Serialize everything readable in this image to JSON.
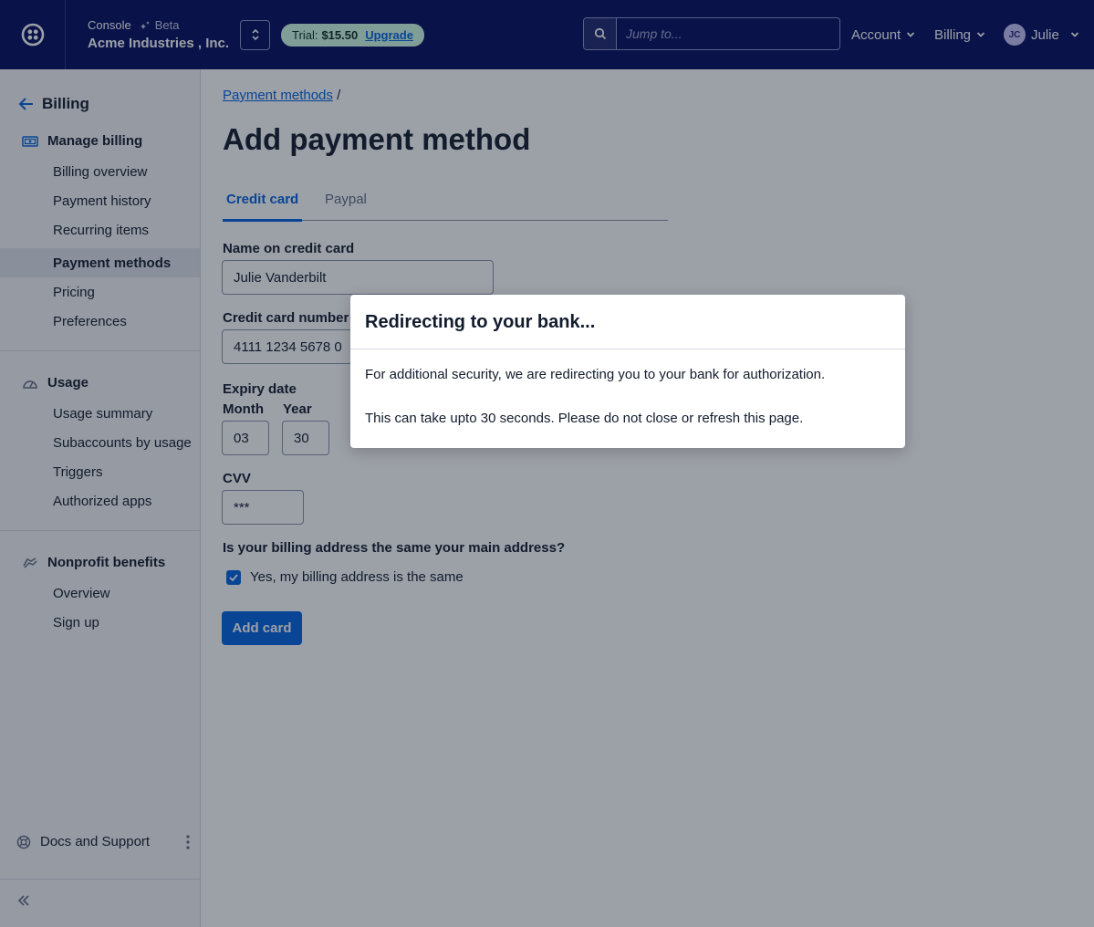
{
  "header": {
    "console_label": "Console",
    "beta_label": "Beta",
    "account_name": "Acme Industries , Inc.",
    "trial_label": "Trial:",
    "trial_amount": "$15.50",
    "upgrade_label": "Upgrade",
    "search_placeholder": "Jump to...",
    "nav": {
      "account": "Account",
      "billing": "Billing",
      "user_initials": "JC",
      "user_name": "Julie"
    }
  },
  "sidebar": {
    "back_label": "Billing",
    "sections": [
      {
        "title": "Manage billing",
        "items": [
          "Billing overview",
          "Payment history",
          "Recurring items",
          "Payment methods",
          "Pricing",
          "Preferences"
        ]
      },
      {
        "title": "Usage",
        "items": [
          "Usage summary",
          "Subaccounts by usage",
          "Triggers",
          "Authorized apps"
        ]
      },
      {
        "title": "Nonprofit benefits",
        "items": [
          "Overview",
          "Sign up"
        ]
      }
    ],
    "active_item": "Payment methods",
    "docs_label": "Docs and Support"
  },
  "main": {
    "breadcrumb_link": "Payment methods",
    "breadcrumb_sep": "/",
    "title": "Add payment method",
    "tabs": [
      "Credit card",
      "Paypal"
    ],
    "form": {
      "name_label": "Name on credit card",
      "name_value": "Julie Vanderbilt",
      "number_label": "Credit card number",
      "number_value": "4111 1234 5678 0",
      "expiry_label": "Expiry date",
      "month_label": "Month",
      "month_value": "03",
      "year_label": "Year",
      "year_value": "30",
      "cvv_label": "CVV",
      "cvv_value": "***",
      "billing_question": "Is your billing address the same your main address?",
      "billing_checkbox_label": "Yes, my billing address is the same",
      "submit_label": "Add card"
    }
  },
  "modal": {
    "title": "Redirecting to your bank...",
    "line1": "For additional security, we are redirecting you to your bank for authorization.",
    "line2": "This can take upto 30 seconds. Please do not close or refresh this page."
  }
}
